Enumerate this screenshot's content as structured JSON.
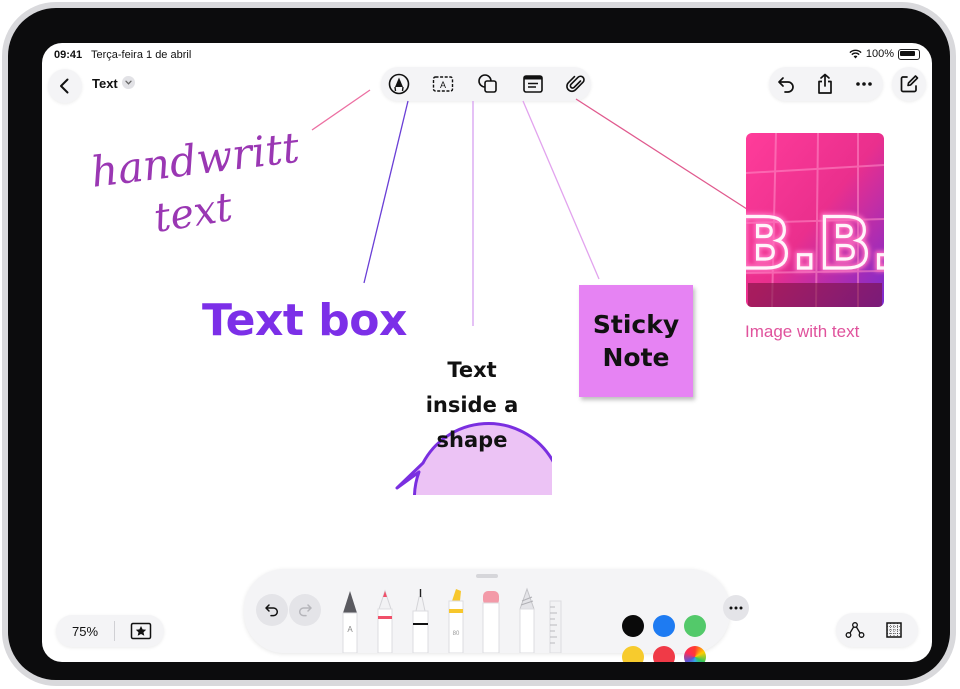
{
  "status_bar": {
    "time": "09:41",
    "date": "Terça-feira 1 de abril",
    "battery": "100%"
  },
  "header": {
    "title": "Text"
  },
  "canvas": {
    "handwritten": [
      "handwritten",
      "text"
    ],
    "text_box": "Text box",
    "shape_text": [
      "Text",
      "inside a",
      "shape"
    ],
    "sticky_note": [
      "Sticky",
      "Note"
    ],
    "image_letters": "B.B.",
    "image_caption": "Image with text"
  },
  "bottom_left": {
    "zoom": "75%"
  },
  "toolbar_icons": {
    "top_center": [
      "pen-circle-icon",
      "text-box-icon",
      "shapes-icon",
      "sticky-note-icon",
      "paperclip-icon"
    ],
    "top_right": [
      "undo-icon",
      "share-icon",
      "more-icon",
      "compose-icon"
    ],
    "bottom_right": [
      "connector-icon",
      "grid-icon"
    ]
  },
  "palette": {
    "colors": [
      "#0a0a0a",
      "#1e7bf2",
      "#53c96a",
      "#f7cb2d",
      "#f03a47"
    ],
    "accent": "#7c2fe8",
    "callout_colors": [
      "#ec6fa2",
      "#6a3fd6",
      "#d7a0f0",
      "#e2a3ee",
      "#e05a8e"
    ]
  }
}
